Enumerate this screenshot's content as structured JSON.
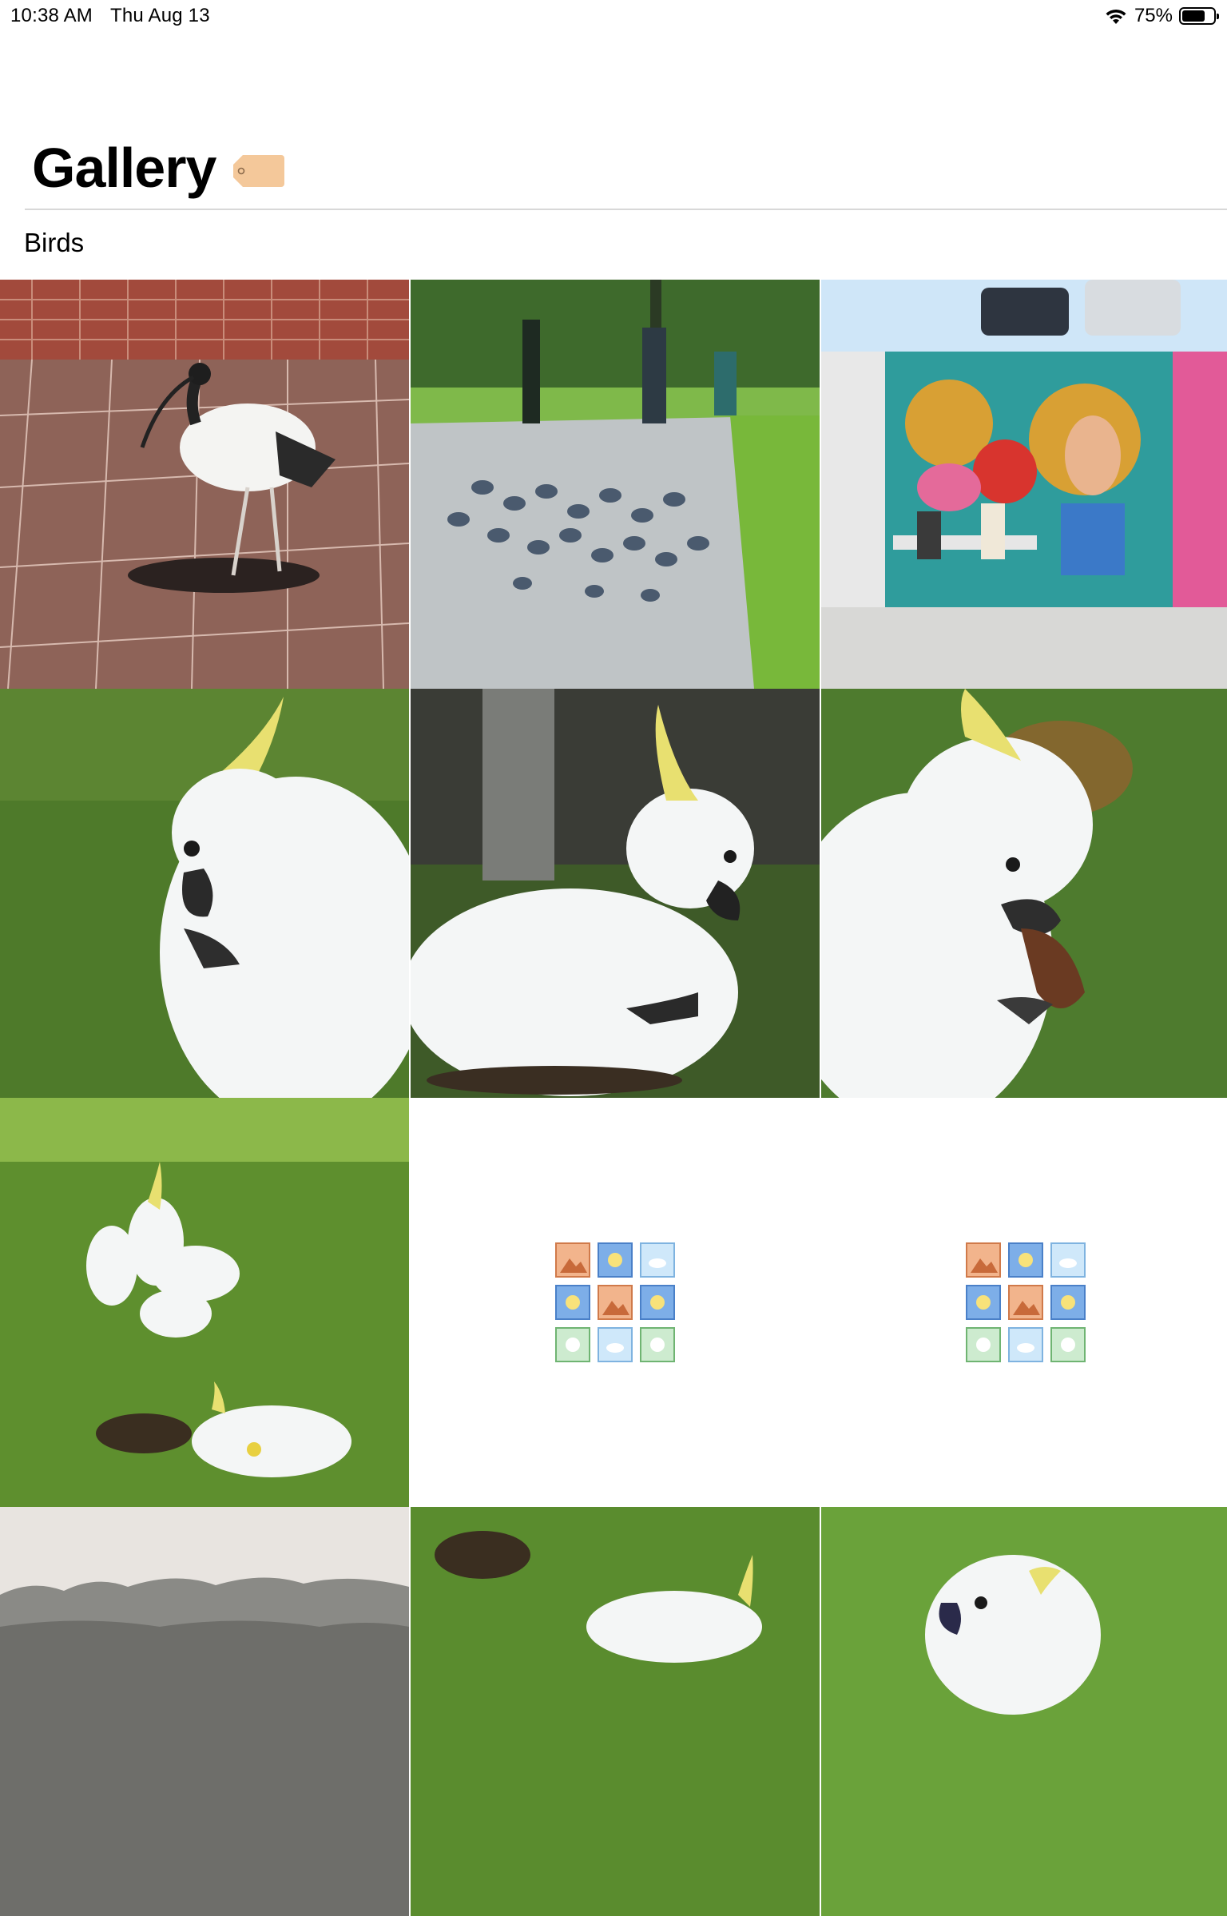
{
  "status_bar": {
    "time": "10:38 AM",
    "date": "Thu Aug 13",
    "battery_percent_text": "75%",
    "battery_level": 0.75,
    "icons": [
      "wifi-icon",
      "battery-icon"
    ]
  },
  "header": {
    "title": "Gallery",
    "title_icon": "tag-icon",
    "tag_color": "#F4C89A"
  },
  "section": {
    "label": "Birds"
  },
  "grid": {
    "tiles": [
      {
        "kind": "photo",
        "subject": "ibis"
      },
      {
        "kind": "photo",
        "subject": "pigeons"
      },
      {
        "kind": "photo",
        "subject": "mural"
      },
      {
        "kind": "photo",
        "subject": "cockatoo"
      },
      {
        "kind": "photo",
        "subject": "cockatoo"
      },
      {
        "kind": "photo",
        "subject": "cockatoo"
      },
      {
        "kind": "photo",
        "subject": "cockatoos"
      },
      {
        "kind": "placeholder",
        "icon": "image-grid-placeholder-icon"
      },
      {
        "kind": "placeholder",
        "icon": "image-grid-placeholder-icon"
      },
      {
        "kind": "photo",
        "subject": "trees"
      },
      {
        "kind": "photo",
        "subject": "cockatoo"
      },
      {
        "kind": "photo",
        "subject": "cockatoo"
      }
    ]
  },
  "colors": {
    "grass": "#5E8F2E",
    "sky": "#CFE6F8",
    "brick": "#A0483A",
    "cockatoo_white": "#F4F6F6",
    "crest_yellow": "#E8E070"
  }
}
